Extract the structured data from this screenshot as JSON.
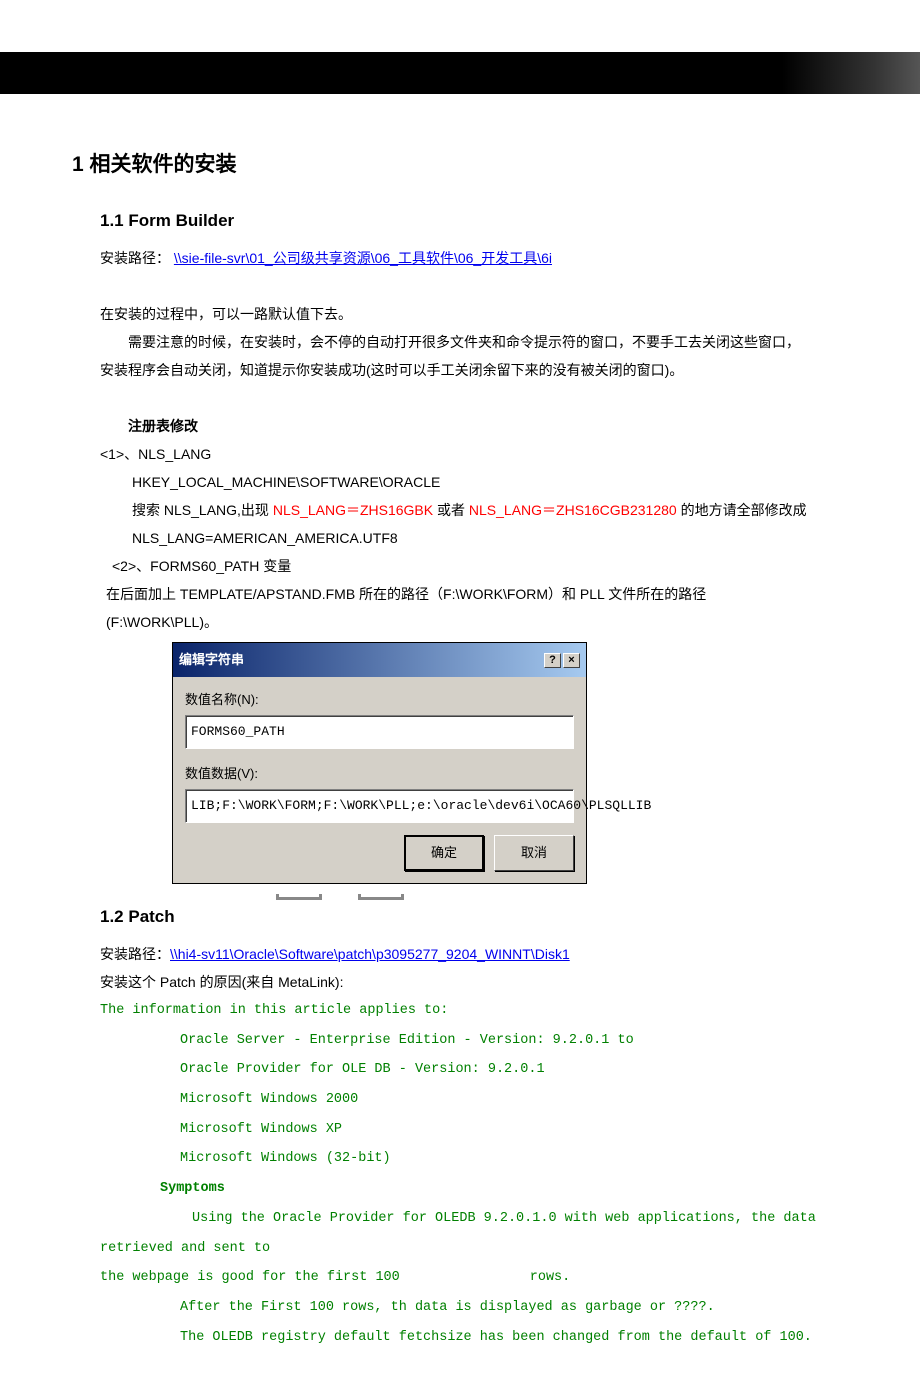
{
  "h1": "1  相关软件的安装",
  "s11": {
    "title": "1.1 Form Builder",
    "path_label": "安装路径：",
    "path_link": "\\\\sie-file-svr\\01_公司级共享资源\\06_工具软件\\06_开发工具\\6i",
    "p1": "在安装的过程中，可以一路默认值下去。",
    "p2_a": "需要注意的时候，在安装时，会不停的自动打开很多文件夹和命令提示符的窗口，不要手工去关闭这些窗口，",
    "p2_b": "安装程序会自动关闭，知道提示你安装成功(这时可以手工关闭余留下来的没有被关闭的窗口)。",
    "reg_title": "注册表修改",
    "r1": "<1>、NLS_LANG",
    "r1_a": "HKEY_LOCAL_MACHINE\\SOFTWARE\\ORACLE",
    "r1_b_pre": "搜索 NLS_LANG,出现 ",
    "r1_b_red1": "NLS_LANG＝ZHS16GBK",
    "r1_b_mid": " 或者 ",
    "r1_b_red2": "NLS_LANG＝ZHS16CGB231280",
    "r1_b_post": " 的地方请全部修改成",
    "r1_c": "NLS_LANG=AMERICAN_AMERICA.UTF8",
    "r2": "<2>、FORMS60_PATH 变量",
    "r2_a": "在后面加上 TEMPLATE/APSTAND.FMB 所在的路径（F:\\WORK\\FORM）和 PLL 文件所在的路径",
    "r2_b": "(F:\\WORK\\PLL)。"
  },
  "dialog": {
    "title": "编辑字符串",
    "help": "?",
    "close": "×",
    "name_label": "数值名称(N):",
    "name_value": "FORMS60_PATH",
    "data_label": "数值数据(V):",
    "data_value": "LIB;F:\\WORK\\FORM;F:\\WORK\\PLL;e:\\oracle\\dev6i\\OCA60\\PLSQLLIB",
    "ok": "确定",
    "cancel": "取消"
  },
  "s12": {
    "title": "1.2 Patch",
    "path_label": "安装路径：",
    "path_link": "\\\\hi4-sv11\\Oracle\\Software\\patch\\p3095277_9204_WINNT\\Disk1",
    "reason": "安装这个 Patch 的原因(来自 MetaLink):",
    "g1": "The information in this article applies to:",
    "g2": "Oracle Server - Enterprise Edition - Version: 9.2.0.1 to",
    "g3": "Oracle Provider for OLE DB - Version: 9.2.0.1",
    "g4": "Microsoft Windows 2000",
    "g5": "Microsoft Windows XP",
    "g6": "Microsoft Windows (32-bit)",
    "symptoms": "Symptoms",
    "sym1_a": "Using the Oracle Provider for OLEDB 9.2.0.1.0 with web applications, the data retrieved and sent to",
    "sym1_b": "the webpage is good for the first 100",
    "sym1_c": "rows.",
    "sym2": "After the First 100 rows, th data is displayed as garbage or ????.",
    "sym3": "The OLEDB registry default fetchsize has been changed from the default of 100."
  }
}
